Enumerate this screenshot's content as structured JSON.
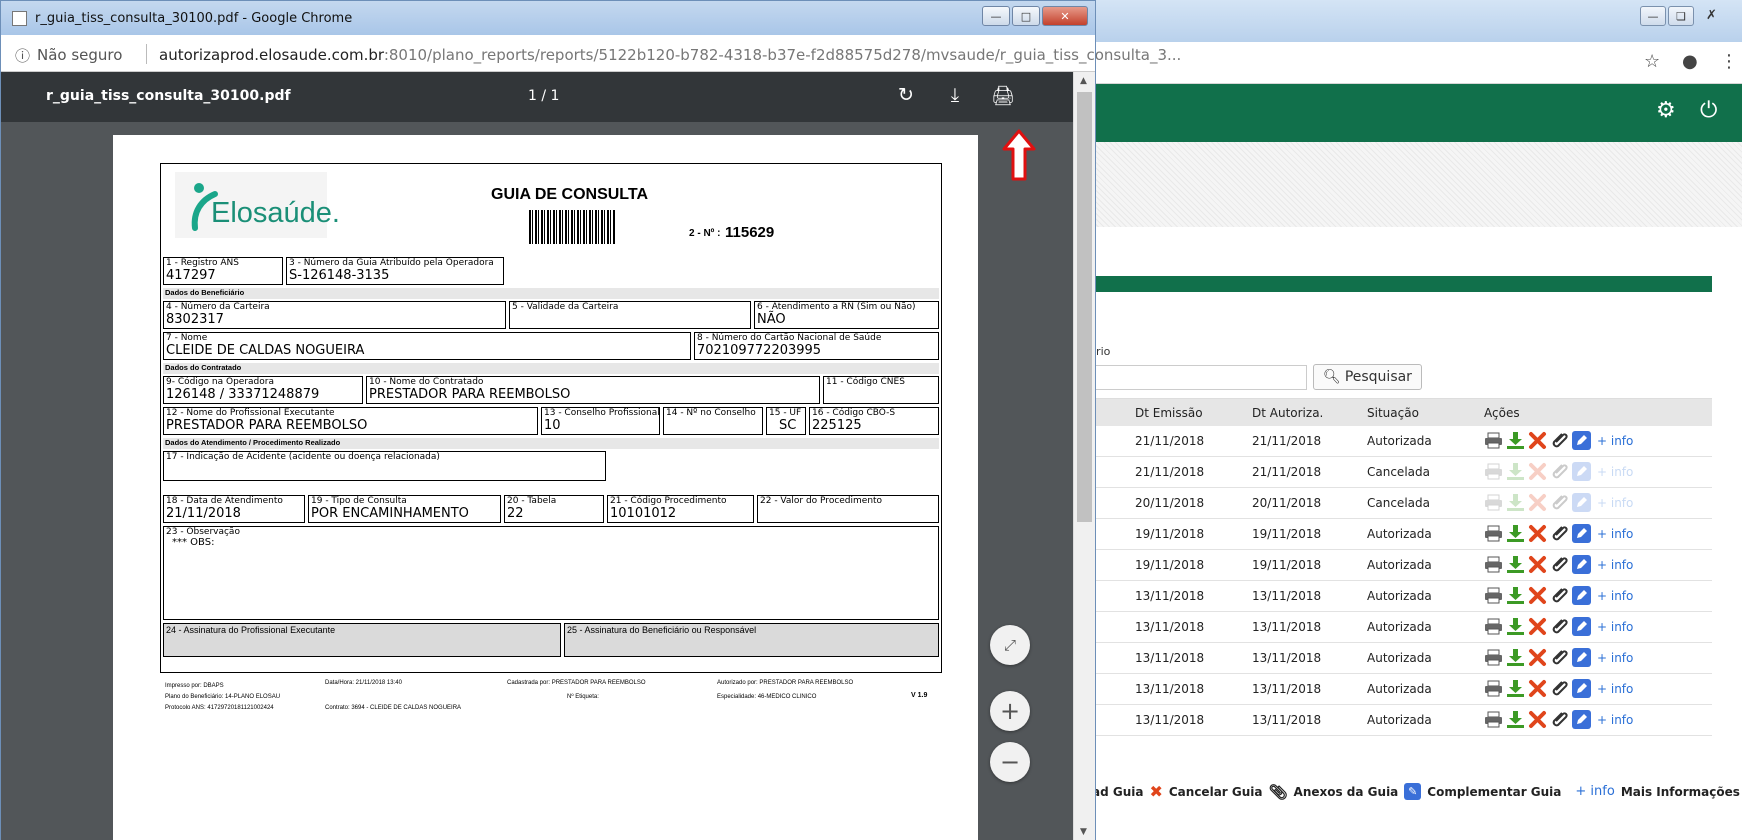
{
  "window": {
    "title": "r_guia_tiss_consulta_30100.pdf - Google Chrome",
    "security": "Não seguro",
    "url_host": "autorizaprod.elosaude.com.br",
    "url_rest": ":8010/plano_reports/reports/5122b120-b782-4318-b37e-f2d88575d278/mvsaude/r_guia_tiss_consulta_3..."
  },
  "pdf_toolbar": {
    "filename": "r_guia_tiss_consulta_30100.pdf",
    "pages": "1 / 1"
  },
  "form": {
    "logo": "Elosaúde.",
    "title": "GUIA DE CONSULTA",
    "number_label": "2 - Nº :",
    "number": "115629",
    "registro_ans_label": "1 - Registro ANS",
    "registro_ans": "417297",
    "num_guia_label": "3 - Número da Guia Atribuído pela Operadora",
    "num_guia": "S-126148-3135",
    "sec_beneficiario": "Dados do Beneficiário",
    "carteira_label": "4 - Número da Carteira",
    "carteira": "8302317",
    "validade_label": "5 - Validade da Carteira",
    "rn_label": "6 - Atendimento a RN (Sim ou Não)",
    "rn": "NÃO",
    "nome_label": "7 - Nome",
    "nome": "CLEIDE DE CALDAS NOGUEIRA",
    "cns_label": "8 - Número do Cartão Nacional de Saúde",
    "cns": "702109772203995",
    "sec_contratado": "Dados do Contratado",
    "cod_operadora_label": "9- Código na Operadora",
    "cod_operadora": "126148 / 33371248879",
    "nome_contratado_label": "10 - Nome do Contratado",
    "nome_contratado": "PRESTADOR PARA REEMBOLSO",
    "cnes_label": "11 - Código CNES",
    "prof_label": "12 - Nome do Profissional Executante",
    "prof": "PRESTADOR PARA REEMBOLSO",
    "conselho_label": "13 - Conselho Profissional",
    "conselho": "10",
    "num_conselho_label": "14 - Nº no Conselho",
    "uf_label": "15 - UF",
    "uf": "SC",
    "cbo_label": "16 - Código CBO-S",
    "cbo": "225125",
    "sec_atendimento": "Dados do Atendimento / Procedimento Realizado",
    "acidente_label": "17 - Indicação de Acidente (acidente ou doença relacionada)",
    "data_label": "18 - Data de Atendimento",
    "data": "21/11/2018",
    "tipo_label": "19 - Tipo de Consulta",
    "tipo": "POR ENCAMINHAMENTO",
    "tabela_label": "20 - Tabela",
    "tabela": "22",
    "cod_proc_label": "21 - Código Procedimento",
    "cod_proc": "10101012",
    "valor_label": "22 - Valor do Procedimento",
    "obs_label": "23 - Observação",
    "obs": "*** OBS:",
    "assin_prof_label": "24 - Assinatura do Profissional Executante",
    "assin_benef_label": "25 - Assinatura do Beneficiário ou Responsável",
    "footer": {
      "impresso": "Impresso por: DBAPS",
      "plano": "Plano do Beneficiário: 14-PLANO ELOSAU",
      "protocolo": "Protocolo ANS: 41729720181121002424",
      "datahora": "Data/Hora: 21/11/2018 13:40",
      "contrato": "Contrato: 3694 - CLEIDE DE CALDAS NOGUEIRA",
      "cadastrada": "Cadastrada por: PRESTADOR PARA REEMBOLSO",
      "etiqueta": "Nº Etiqueta:",
      "autorizado": "Autorizado por: PRESTADOR PARA REEMBOLSO",
      "especialidade": "Especialidade: 46-MEDICO CLINICO",
      "versao": "V 1.9"
    }
  },
  "background_page": {
    "label_fragment": "irio",
    "search_button": "Pesquisar",
    "columns": [
      "Dt Emissão",
      "Dt Autoriza.",
      "Situação",
      "Ações"
    ],
    "rows": [
      {
        "emissao": "21/11/2018",
        "autoriza": "21/11/2018",
        "situacao": "Autorizada",
        "enabled": true
      },
      {
        "emissao": "21/11/2018",
        "autoriza": "21/11/2018",
        "situacao": "Cancelada",
        "enabled": false
      },
      {
        "emissao": "20/11/2018",
        "autoriza": "20/11/2018",
        "situacao": "Cancelada",
        "enabled": false
      },
      {
        "emissao": "19/11/2018",
        "autoriza": "19/11/2018",
        "situacao": "Autorizada",
        "enabled": true
      },
      {
        "emissao": "19/11/2018",
        "autoriza": "19/11/2018",
        "situacao": "Autorizada",
        "enabled": true
      },
      {
        "emissao": "13/11/2018",
        "autoriza": "13/11/2018",
        "situacao": "Autorizada",
        "enabled": true
      },
      {
        "emissao": "13/11/2018",
        "autoriza": "13/11/2018",
        "situacao": "Autorizada",
        "enabled": true
      },
      {
        "emissao": "13/11/2018",
        "autoriza": "13/11/2018",
        "situacao": "Autorizada",
        "enabled": true
      },
      {
        "emissao": "13/11/2018",
        "autoriza": "13/11/2018",
        "situacao": "Autorizada",
        "enabled": true
      },
      {
        "emissao": "13/11/2018",
        "autoriza": "13/11/2018",
        "situacao": "Autorizada",
        "enabled": true
      }
    ],
    "more_info": "+ info",
    "legend": {
      "download": "ad Guia",
      "cancel": "Cancelar Guia",
      "attach": "Anexos da Guia",
      "complement": "Complementar Guia",
      "info_sym": "+ info",
      "info": "Mais Informações"
    }
  },
  "icons": [
    "printer-icon",
    "download-icon",
    "cancel-icon",
    "paperclip-icon",
    "edit-icon",
    "search-icon",
    "gear-icon",
    "power-icon",
    "star-icon",
    "account-icon",
    "rotate-icon",
    "info-icon"
  ],
  "colors": {
    "brand_green": "#11704b",
    "pdf_toolbar": "#323639",
    "pdf_bg": "#525659",
    "cancel_red": "#e0451b",
    "download_green": "#3c9a25",
    "edit_blue": "#3a6fd8",
    "arrow_red": "#e01010"
  }
}
